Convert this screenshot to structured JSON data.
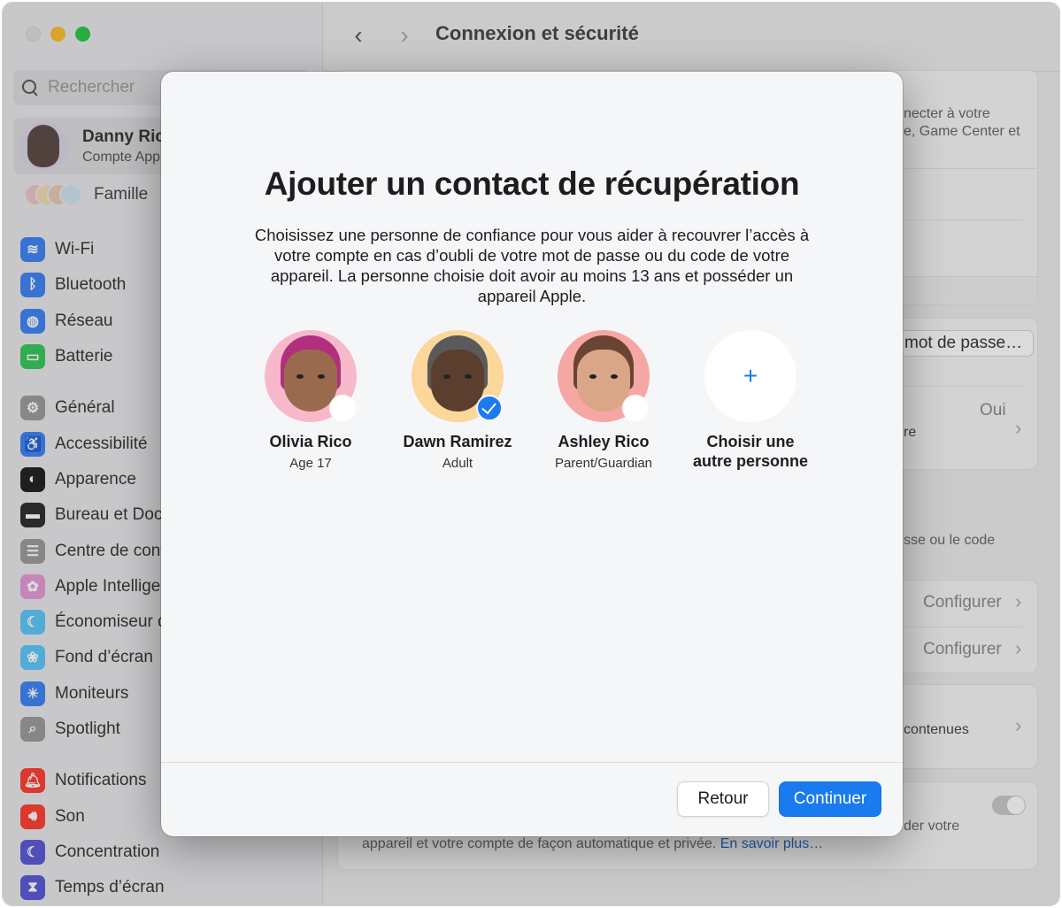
{
  "window": {
    "title": "Connexion et sécurité",
    "nav_back_icon": "chevron-left-icon",
    "nav_forward_icon": "chevron-right-icon"
  },
  "sidebar": {
    "search_placeholder": "Rechercher",
    "account": {
      "name": "Danny Rico",
      "subtitle": "Compte Apple"
    },
    "family_label": "Famille",
    "items": [
      {
        "label": "Wi-Fi",
        "icon": "wifi-icon",
        "color": "#3b82f6",
        "glyph": "≋"
      },
      {
        "label": "Bluetooth",
        "icon": "bluetooth-icon",
        "color": "#3b82f6",
        "glyph": "ᛒ"
      },
      {
        "label": "Réseau",
        "icon": "globe-icon",
        "color": "#3b82f6",
        "glyph": "◍"
      },
      {
        "label": "Batterie",
        "icon": "battery-icon",
        "color": "#34c759",
        "glyph": "▭"
      },
      {
        "label": "Général",
        "icon": "gear-icon",
        "color": "#9a9a9a",
        "glyph": "⚙"
      },
      {
        "label": "Accessibilité",
        "icon": "accessibility-icon",
        "color": "#3b82f6",
        "glyph": "♿"
      },
      {
        "label": "Apparence",
        "icon": "appearance-icon",
        "color": "#1d1d1f",
        "glyph": "◐"
      },
      {
        "label": "Bureau et Dock",
        "icon": "dock-icon",
        "color": "#2b2b2b",
        "glyph": "▬"
      },
      {
        "label": "Centre de contrôle",
        "icon": "control-center-icon",
        "color": "#9a9a9a",
        "glyph": "☰"
      },
      {
        "label": "Apple Intelligence",
        "icon": "apple-intelligence-icon",
        "color": "#e59ad9",
        "glyph": "✿"
      },
      {
        "label": "Économiseur d'écran",
        "icon": "screensaver-icon",
        "color": "#5ac8fa",
        "glyph": "☾"
      },
      {
        "label": "Fond d’écran",
        "icon": "wallpaper-icon",
        "color": "#5ac8fa",
        "glyph": "❀"
      },
      {
        "label": "Moniteurs",
        "icon": "display-icon",
        "color": "#3b82f6",
        "glyph": "☀"
      },
      {
        "label": "Spotlight",
        "icon": "spotlight-icon",
        "color": "#9a9a9a",
        "glyph": "⌕"
      },
      {
        "label": "Notifications",
        "icon": "bell-icon",
        "color": "#ff3b30",
        "glyph": "🔔︎"
      },
      {
        "label": "Son",
        "icon": "speaker-icon",
        "color": "#ff3b30",
        "glyph": "🔊︎"
      },
      {
        "label": "Concentration",
        "icon": "moon-icon",
        "color": "#5856d6",
        "glyph": "☾"
      },
      {
        "label": "Temps d’écran",
        "icon": "hourglass-icon",
        "color": "#5856d6",
        "glyph": "⧗"
      }
    ]
  },
  "background_pane": {
    "intro_text_line1": "necter à votre",
    "intro_text_line2": "e, Game Center et",
    "change_password_button": "mot de passe…",
    "row_value_oui": "Oui",
    "row_label_re": "re",
    "recovery_text": "sse ou le code",
    "configure_1": "Configurer",
    "configure_2": "Configurer",
    "contenues_label": "contenues",
    "bottom_text_right": "der votre",
    "bottom_text": "appareil et votre compte de façon automatique et privée.",
    "learn_more_link": "En savoir plus…"
  },
  "dialog": {
    "title": "Ajouter un contact de récupération",
    "description": "Choisissez une personne de confiance pour vous aider à recouvrer l’accès à votre compte en cas d’oubli de votre mot de passe ou du code de votre appareil. La personne choisie doit avoir au moins 13 ans et posséder un appareil Apple.",
    "contacts": [
      {
        "name": "Olivia Rico",
        "subtitle": "Age 17",
        "selected": false,
        "bg": "#f7b9c9",
        "skin": "#9a6a4e",
        "hair": "#b0307f"
      },
      {
        "name": "Dawn Ramirez",
        "subtitle": "Adult",
        "selected": true,
        "bg": "#fbd79c",
        "skin": "#5c3e2f",
        "hair": "#5a5a5a"
      },
      {
        "name": "Ashley Rico",
        "subtitle": "Parent/Guardian",
        "selected": false,
        "bg": "#f5a7a3",
        "skin": "#d9a688",
        "hair": "#6a4432"
      }
    ],
    "add_other": {
      "label": "Choisir une autre personne",
      "icon": "plus-icon",
      "glyph": "+"
    },
    "back_button": "Retour",
    "continue_button": "Continuer"
  },
  "colors": {
    "accent": "#1a7af0",
    "close_dot": "#dcdcdc",
    "minimize_dot": "#febc2e",
    "maximize_dot": "#28c840"
  }
}
